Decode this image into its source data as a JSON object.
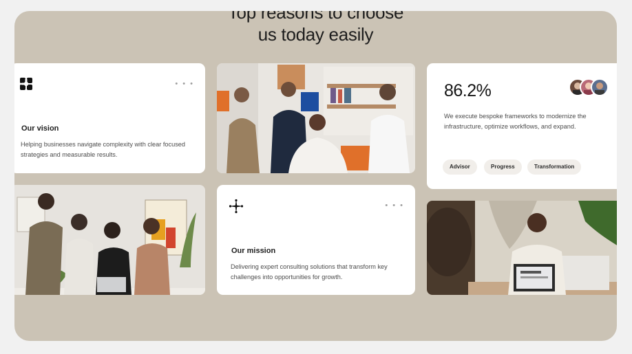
{
  "heading": {
    "line1": "Top reasons to choose",
    "line2": "us today easily"
  },
  "vision_card": {
    "title": "Our vision",
    "description": "Helping businesses navigate complexity with clear focused strategies and measurable results.",
    "menu": "• • •",
    "icon": "knot-logo-icon"
  },
  "mission_card": {
    "title": "Our mission",
    "description": "Delivering expert consulting solutions that transform key challenges into opportunities for growth.",
    "menu": "• • •",
    "icon": "sparkle-cross-icon"
  },
  "stat_card": {
    "value": "86.2%",
    "description": "We execute bespoke frameworks to modernize the infrastructure, optimize workflows, and expand.",
    "tags": [
      "Advisor",
      "Progress",
      "Transformation"
    ],
    "avatars": [
      "avatar-1",
      "avatar-2",
      "avatar-3"
    ]
  },
  "colors": {
    "frame_background": "#cbc3b5",
    "card_background": "#ffffff",
    "tag_background": "#f1eeea"
  }
}
